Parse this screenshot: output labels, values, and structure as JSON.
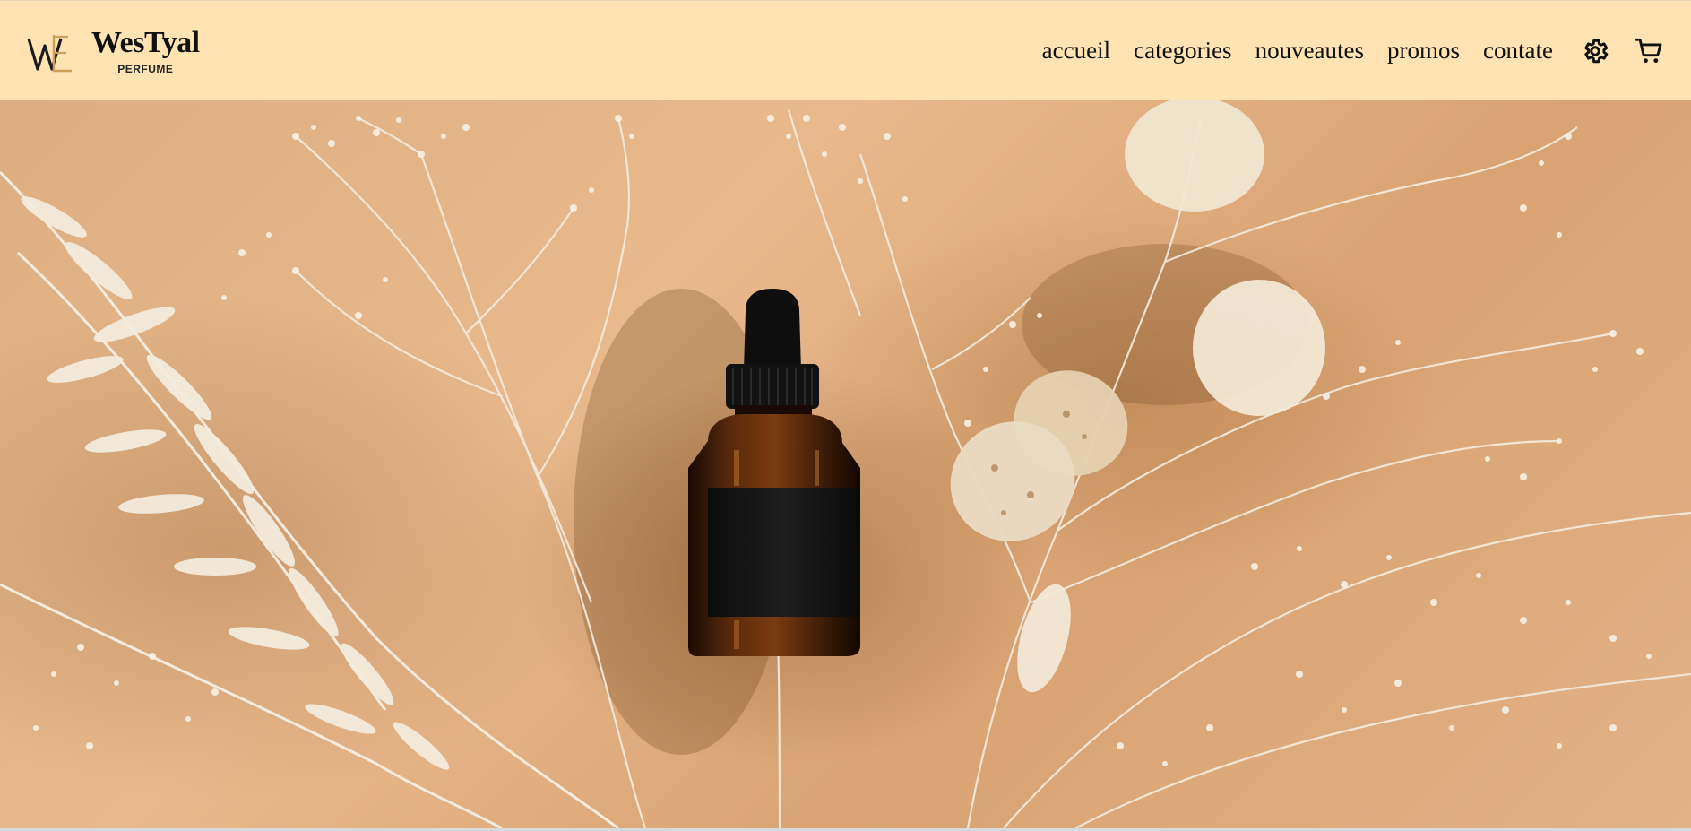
{
  "brand": {
    "name": "WesTyal",
    "subtitle": "PERFUME",
    "monogram_icon": "wy-monogram-logo"
  },
  "nav": {
    "links": [
      {
        "label": "accueil"
      },
      {
        "label": "categories"
      },
      {
        "label": "nouveautes"
      },
      {
        "label": "promos"
      },
      {
        "label": "contate"
      }
    ],
    "settings_icon": "gear-icon",
    "cart_icon": "cart-icon"
  },
  "hero": {
    "image": "dropper bottle with dried white flowers on beige background"
  },
  "colors": {
    "header_bg": "#ffe3b3",
    "hero_bg": "#dcae82",
    "text": "#111111",
    "bottle": "#3a1a08"
  }
}
